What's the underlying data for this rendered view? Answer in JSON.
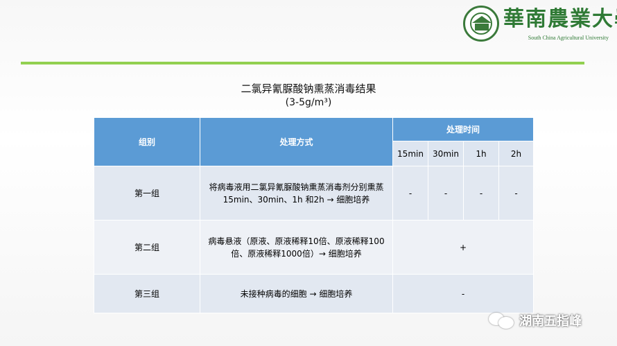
{
  "logo": {
    "chinese": "華南農業大學",
    "english": "South China Agricultural University"
  },
  "title": "二氯异氰脲酸钠熏蒸消毒结果",
  "subtitle": "(3-5g/m³)",
  "table": {
    "headers": {
      "group": "组别",
      "method": "处理方式",
      "time": "处理时间"
    },
    "time_columns": [
      "15min",
      "30min",
      "1h",
      "2h"
    ],
    "rows": [
      {
        "group": "第一组",
        "method": "将病毒液用二氯异氰脲酸钠熏蒸消毒剂分别熏蒸15min、30min、1h 和2h → 细胞培养",
        "results": [
          "-",
          "-",
          "-",
          "-"
        ]
      },
      {
        "group": "第二组",
        "method": "病毒悬液（原液、原液稀释10倍、原液稀释100倍、原液稀释1000倍）→ 细胞培养",
        "result": "+"
      },
      {
        "group": "第三组",
        "method": "未接种病毒的细胞 → 细胞培养",
        "result": "-"
      }
    ]
  },
  "watermark": {
    "icon": "wechat-icon",
    "text": "湖南五指峰"
  },
  "colors": {
    "header_blue": "#5b9bd5",
    "subheader": "#dde5f0",
    "row_bg": "#e2e8f1",
    "divider_green": "#92d050",
    "logo_green": "#2f7a35"
  }
}
